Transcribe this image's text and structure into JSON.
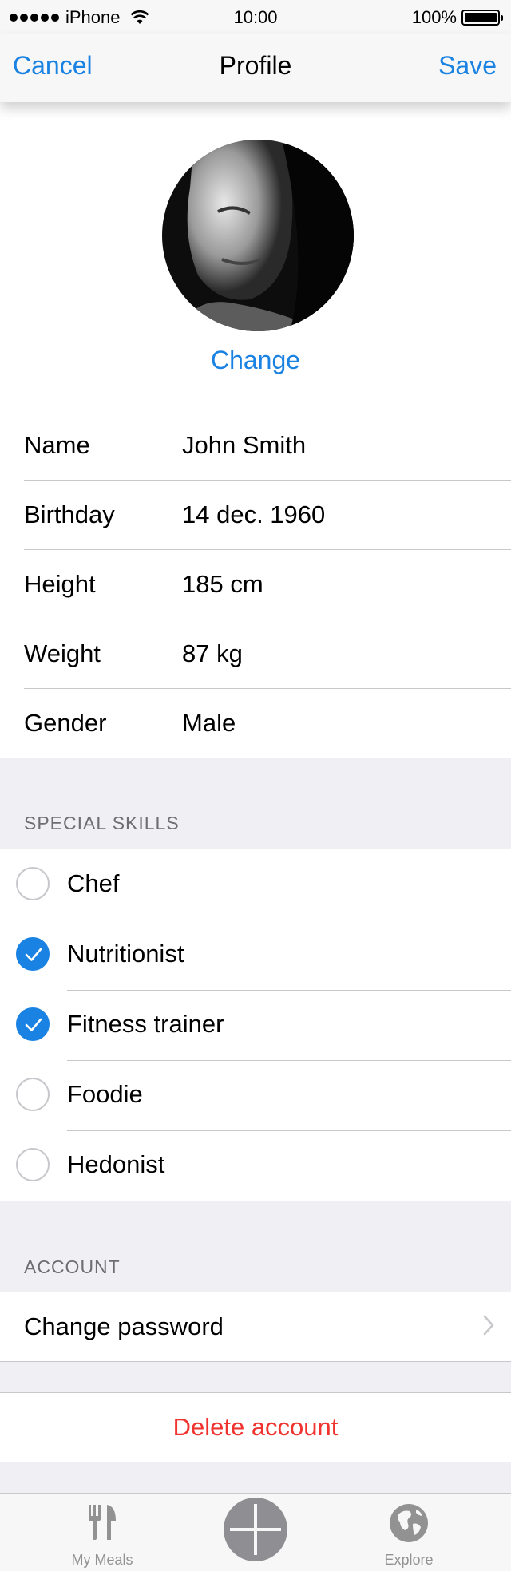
{
  "status_bar": {
    "carrier": "iPhone",
    "time": "10:00",
    "battery": "100%"
  },
  "nav": {
    "cancel_label": "Cancel",
    "title": "Profile",
    "save_label": "Save"
  },
  "avatar": {
    "change_label": "Change"
  },
  "profile_fields": [
    {
      "label": "Name",
      "value": "John Smith"
    },
    {
      "label": "Birthday",
      "value": "14 dec. 1960"
    },
    {
      "label": "Height",
      "value": "185 cm"
    },
    {
      "label": "Weight",
      "value": "87 kg"
    },
    {
      "label": "Gender",
      "value": "Male"
    }
  ],
  "skills": {
    "header": "SPECIAL SKILLS",
    "items": [
      {
        "label": "Chef",
        "checked": false
      },
      {
        "label": "Nutritionist",
        "checked": true
      },
      {
        "label": "Fitness trainer",
        "checked": true
      },
      {
        "label": "Foodie",
        "checked": false
      },
      {
        "label": "Hedonist",
        "checked": false
      }
    ]
  },
  "account": {
    "header": "ACCOUNT",
    "change_password_label": "Change password",
    "delete_label": "Delete account"
  },
  "tabbar": {
    "meals_label": "My Meals",
    "explore_label": "Explore"
  },
  "colors": {
    "accent": "#1a82e2",
    "destructive": "#f0332e",
    "checked": "#1a82e2"
  },
  "icons": [
    "signal-dots-icon",
    "wifi-icon",
    "battery-icon",
    "checkmark-icon",
    "chevron-right-icon",
    "fork-knife-icon",
    "plus-icon",
    "globe-icon"
  ]
}
